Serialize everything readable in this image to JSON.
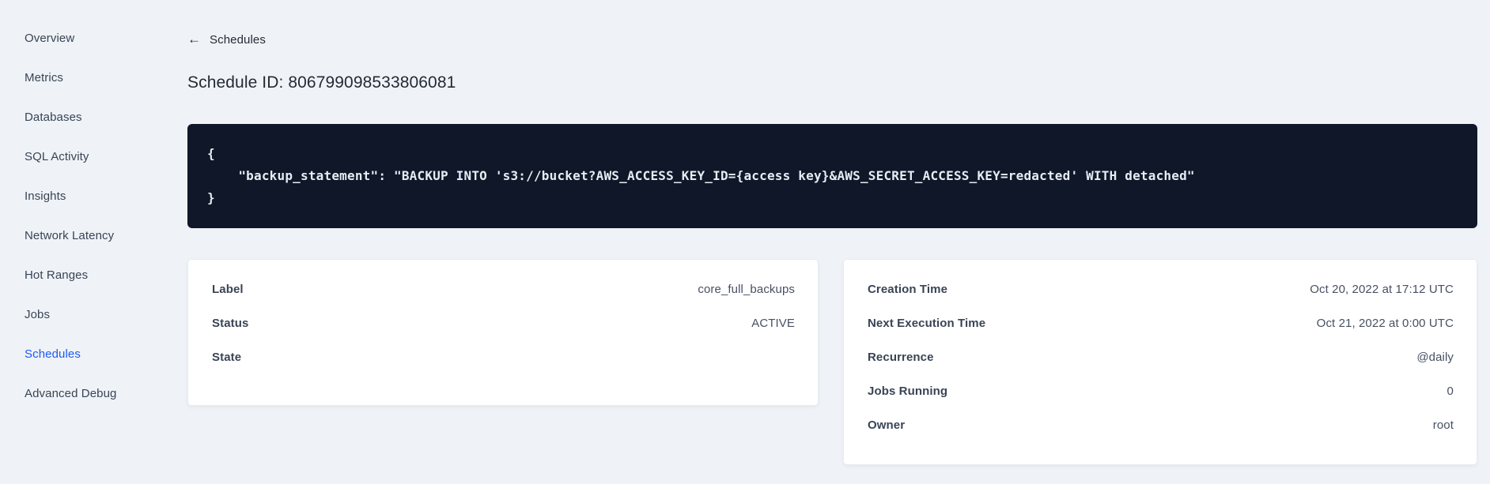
{
  "sidebar": {
    "items": [
      {
        "label": "Overview",
        "active": false
      },
      {
        "label": "Metrics",
        "active": false
      },
      {
        "label": "Databases",
        "active": false
      },
      {
        "label": "SQL Activity",
        "active": false
      },
      {
        "label": "Insights",
        "active": false
      },
      {
        "label": "Network Latency",
        "active": false
      },
      {
        "label": "Hot Ranges",
        "active": false
      },
      {
        "label": "Jobs",
        "active": false
      },
      {
        "label": "Schedules",
        "active": true
      },
      {
        "label": "Advanced Debug",
        "active": false
      }
    ]
  },
  "header": {
    "back_icon": "arrow-left-icon",
    "back_arrow_glyph": "←",
    "back_label": "Schedules",
    "title": "Schedule ID: 806799098533806081"
  },
  "code_block": {
    "lines": [
      "{",
      "    \"backup_statement\": \"BACKUP INTO 's3://bucket?AWS_ACCESS_KEY_ID={access key}&AWS_SECRET_ACCESS_KEY=redacted' WITH detached\"",
      "}"
    ]
  },
  "summary_cards": {
    "schedule": {
      "rows": [
        {
          "label": "Label",
          "value": "core_full_backups"
        },
        {
          "label": "Status",
          "value": "ACTIVE"
        },
        {
          "label": "State",
          "value": ""
        }
      ]
    },
    "execution": {
      "rows": [
        {
          "label": "Creation Time",
          "value": "Oct 20, 2022 at 17:12 UTC"
        },
        {
          "label": "Next Execution Time",
          "value": "Oct 21, 2022 at 0:00 UTC"
        },
        {
          "label": "Recurrence",
          "value": "@daily"
        },
        {
          "label": "Jobs Running",
          "value": "0"
        },
        {
          "label": "Owner",
          "value": "root"
        }
      ]
    }
  },
  "colors": {
    "page_background": "#eff3f7",
    "card_background": "#ffffff",
    "code_background": "#0f1729",
    "code_text": "#e7ecf3",
    "nav_text": "#394455",
    "nav_active": "#1e5af5",
    "title_text": "#242a35",
    "label_text": "#394455",
    "value_text": "#475063"
  }
}
